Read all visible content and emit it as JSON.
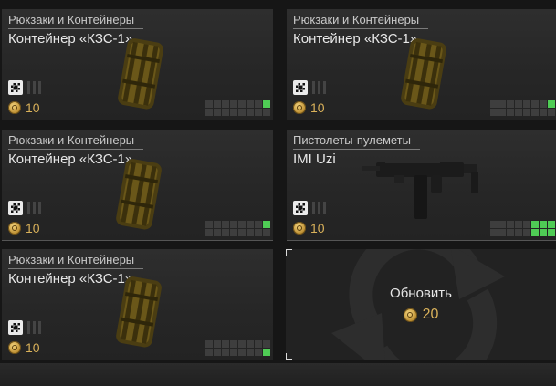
{
  "cards": [
    {
      "category": "Рюкзаки и Контейнеры",
      "name": "Контейнер «КЗС-1»",
      "price": "10",
      "image": "container-image",
      "grid_on": [
        7
      ]
    },
    {
      "category": "Рюкзаки и Контейнеры",
      "name": "Контейнер «КЗС-1»",
      "price": "10",
      "image": "container-image",
      "grid_on": [
        7
      ]
    },
    {
      "category": "Рюкзаки и Контейнеры",
      "name": "Контейнер «КЗС-1»",
      "price": "10",
      "image": "container-image",
      "grid_on": [
        7
      ]
    },
    {
      "category": "Пистолеты-пулеметы",
      "name": "IMI Uzi",
      "price": "10",
      "image": "uzi-image",
      "grid_on": [
        5,
        6,
        7,
        13,
        14,
        15
      ]
    },
    {
      "category": "Рюкзаки и Контейнеры",
      "name": "Контейнер «КЗС-1»",
      "price": "10",
      "image": "container-image",
      "grid_on": [
        15
      ]
    }
  ],
  "refresh": {
    "label": "Обновить",
    "price": "20"
  },
  "colors": {
    "accent_gold": "#d9b15a",
    "grid_on": "#4fcc55",
    "grid_off": "#3e3e3e"
  },
  "icons": {
    "quality": "quality-icon",
    "currency": "coin-icon",
    "refresh": "refresh-arrows-icon"
  }
}
